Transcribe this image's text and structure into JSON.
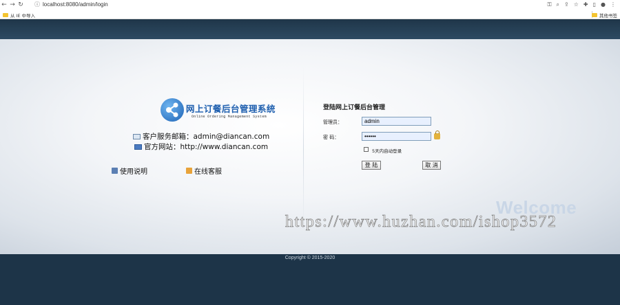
{
  "browser": {
    "url": "localhost:8080/admin/login",
    "bookmark_left": "从 IE 中导入",
    "bookmark_right": "其他书签"
  },
  "logo": {
    "title_cn": "网上订餐后台管理系统",
    "title_en": "Online Ordering Management System"
  },
  "contact": {
    "email": "客户服务邮箱：admin@diancan.com",
    "website": "官方网站：http://www.diancan.com"
  },
  "links": {
    "help": "使用说明",
    "service": "在线客服"
  },
  "login": {
    "title": "登陆网上订餐后台管理",
    "user_label": "管理员：",
    "user_value": "admin",
    "pass_label": "密  码：",
    "pass_value": "••••••",
    "remember": "5天内自动登录",
    "login_btn": "登 陆",
    "cancel_btn": "取 消"
  },
  "welcome": "Welcome",
  "watermark": "https://www.huzhan.com/ishop3572",
  "footer": {
    "copyright": "Copyright © 2015-2020"
  }
}
